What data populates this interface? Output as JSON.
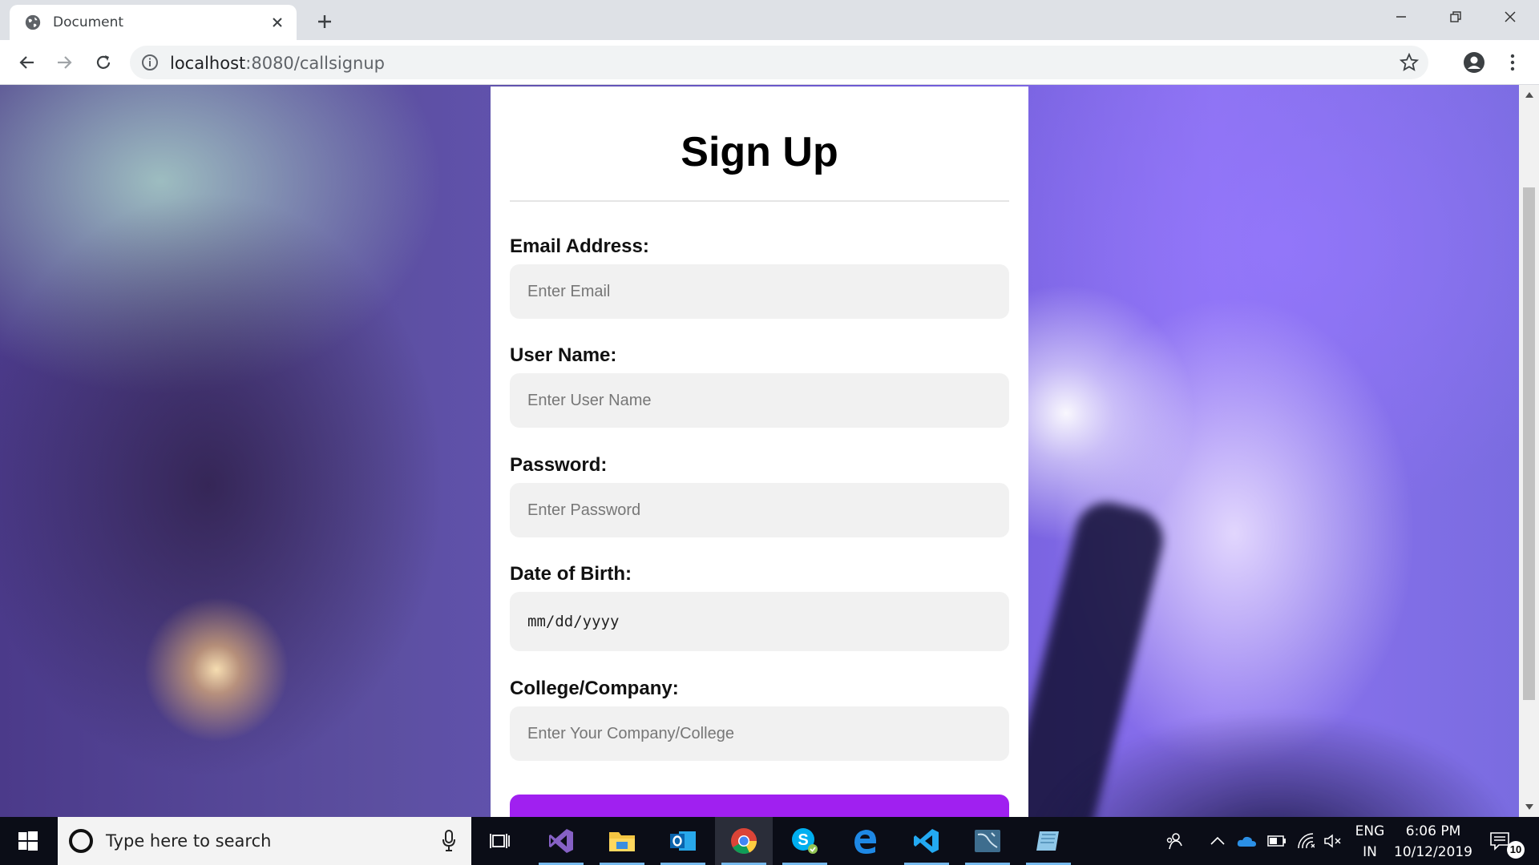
{
  "browser": {
    "tab_title": "Document",
    "url_host": "localhost",
    "url_rest": ":8080/callsignup"
  },
  "form": {
    "title": "Sign Up",
    "fields": [
      {
        "label": "Email Address:",
        "placeholder": "Enter Email"
      },
      {
        "label": "User Name:",
        "placeholder": "Enter User Name"
      },
      {
        "label": "Password:",
        "placeholder": "Enter Password"
      },
      {
        "label": "Date of Birth:",
        "placeholder": "mm/dd/yyyy"
      },
      {
        "label": "College/Company:",
        "placeholder": "Enter Your Company/College"
      }
    ],
    "submit_color": "#a020f0"
  },
  "taskbar": {
    "search_placeholder": "Type here to search",
    "apps": [
      "visual-studio-icon",
      "file-explorer-icon",
      "outlook-icon",
      "chrome-icon",
      "skype-icon",
      "edge-icon",
      "vscode-icon",
      "mysql-workbench-icon",
      "notepad-icon"
    ],
    "active_app": "chrome-icon",
    "language": "ENG",
    "region": "IN",
    "time": "6:06 PM",
    "date": "10/12/2019",
    "notification_count": "10"
  }
}
